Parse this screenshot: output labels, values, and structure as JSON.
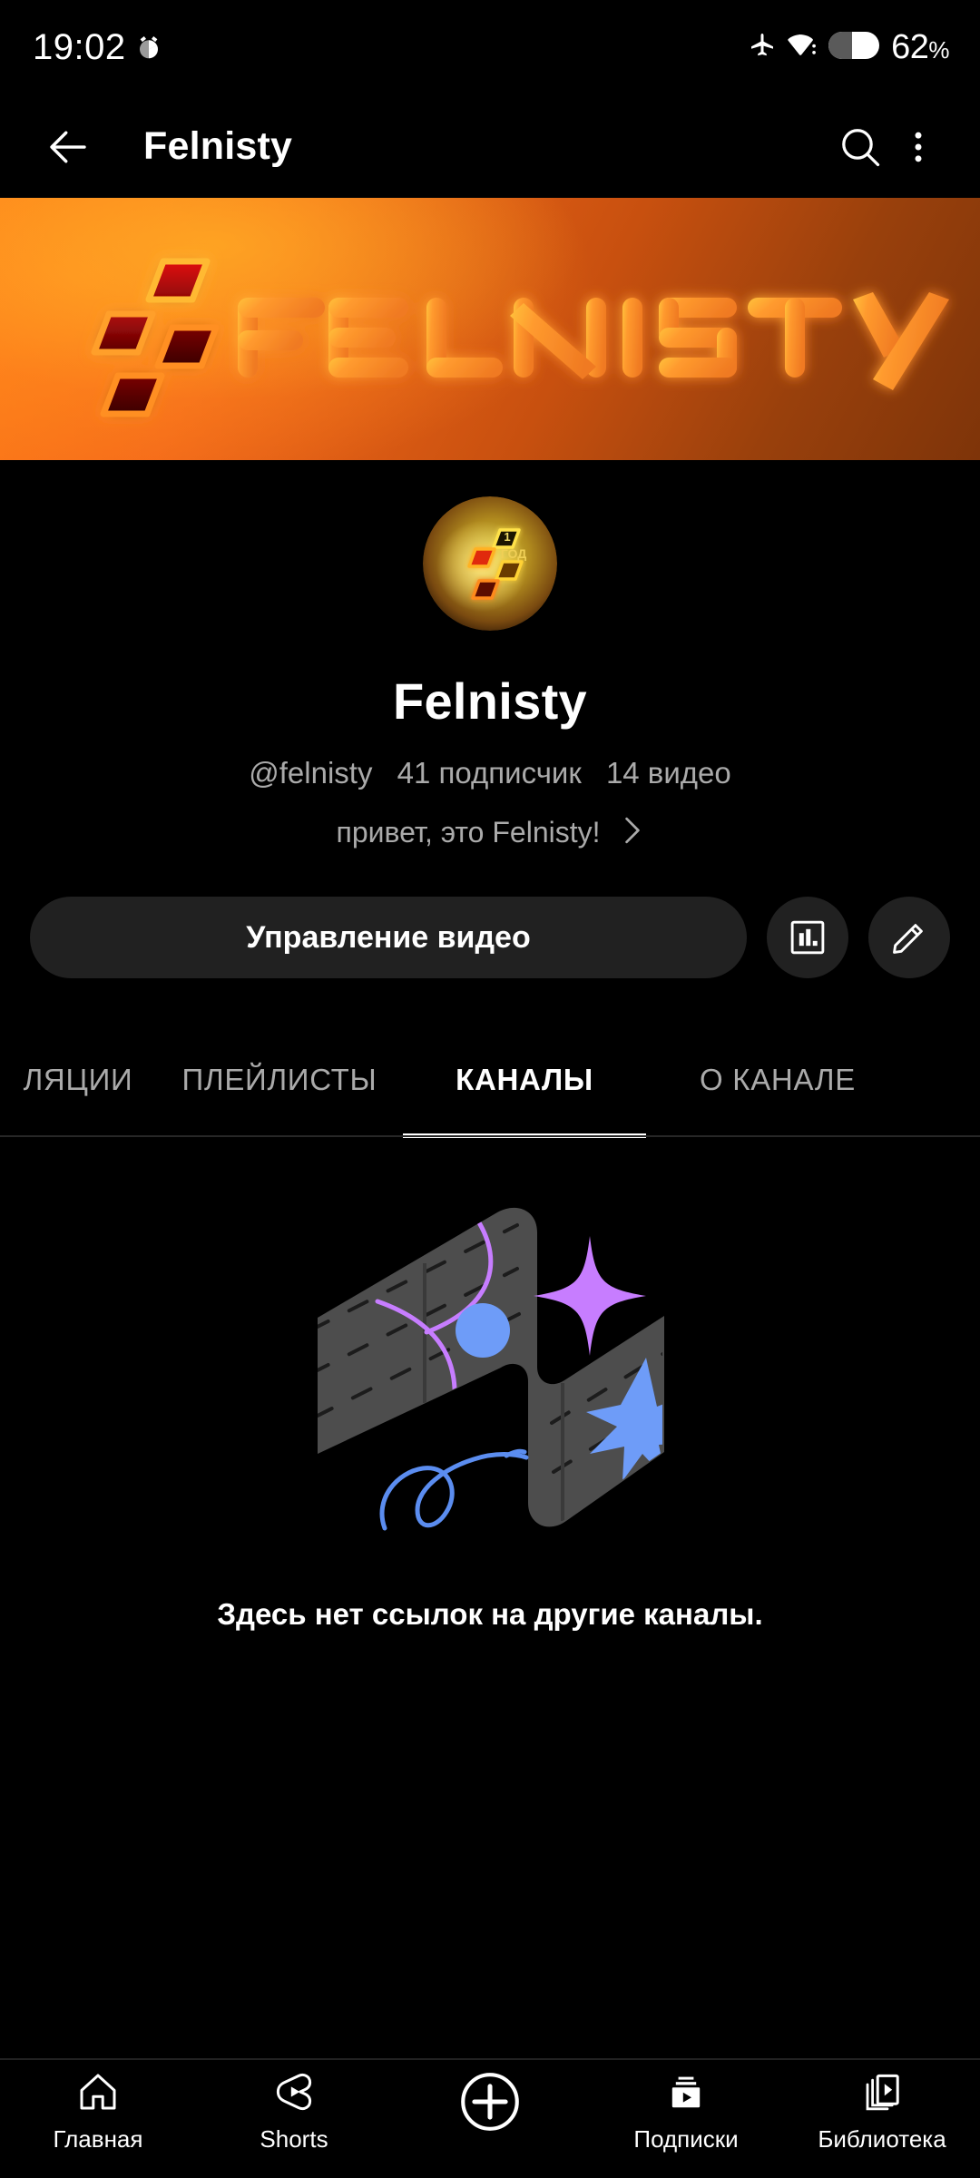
{
  "status_bar": {
    "time": "19:02",
    "alarm_icon": "alarm-clock-icon",
    "airplane_icon": "airplane-mode-icon",
    "wifi_icon": "wifi-icon",
    "battery_level": "62",
    "battery_unit": "%"
  },
  "app_bar": {
    "back_icon": "back-arrow-icon",
    "title": "Felnisty",
    "search_icon": "search-icon",
    "menu_icon": "more-vertical-icon"
  },
  "banner": {
    "logo_text": "FELNISTY",
    "gradient_start": "#ff7d16",
    "gradient_end": "#7e3409"
  },
  "channel": {
    "avatar_badge": "1\nгод",
    "avatar_badge_line1": "1",
    "avatar_badge_line2": "ГОД",
    "name": "Felnisty",
    "handle": "@felnisty",
    "subscribers": "41 подписчик",
    "videos": "14 видео",
    "description": "привет, это Felnisty!",
    "description_chevron": "chevron-right-icon"
  },
  "actions": {
    "manage_label": "Управление видео",
    "analytics_icon": "analytics-bar-chart-icon",
    "edit_icon": "pencil-edit-icon"
  },
  "tabs": [
    {
      "label": "ЛЯЦИИ",
      "active": false
    },
    {
      "label": "ПЛЕЙЛИСТЫ",
      "active": false
    },
    {
      "label": "КАНАЛЫ",
      "active": true
    },
    {
      "label": "О КАНАЛЕ",
      "active": false
    }
  ],
  "empty_state": {
    "illustration": "empty-channels-illustration",
    "message": "Здесь нет ссылок на другие каналы."
  },
  "bottom_nav": [
    {
      "label": "Главная",
      "icon": "home-icon"
    },
    {
      "label": "Shorts",
      "icon": "shorts-icon"
    },
    {
      "label": "",
      "icon": "create-plus-icon"
    },
    {
      "label": "Подписки",
      "icon": "subscriptions-icon"
    },
    {
      "label": "Библиотека",
      "icon": "library-icon"
    }
  ],
  "colors": {
    "background": "#000000",
    "surface": "#212121",
    "text_primary": "#ffffff",
    "text_secondary": "#aaaaaa",
    "accent_purple": "#c77dff",
    "accent_blue": "#6e9cf8",
    "illustration_gray": "#4d4d4d"
  }
}
